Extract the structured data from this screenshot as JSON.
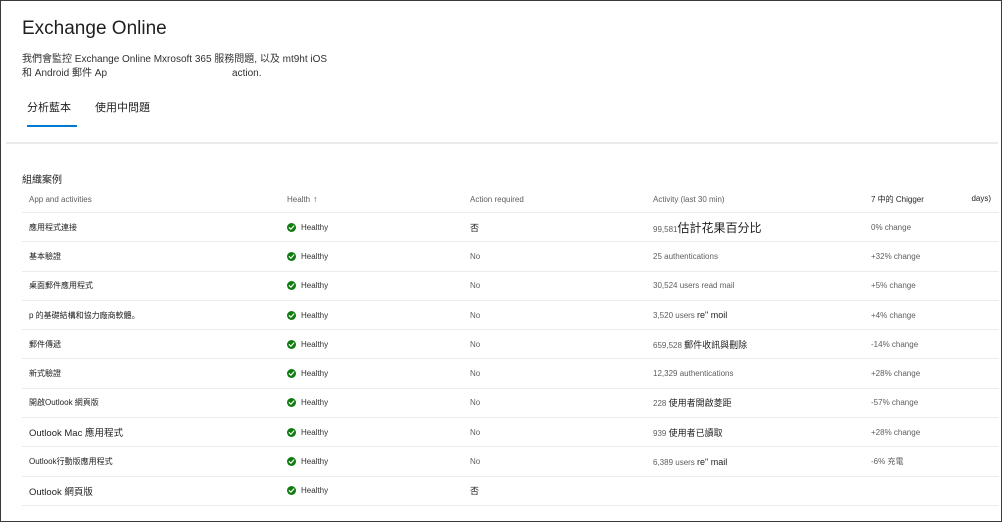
{
  "header": {
    "title": "Exchange Online",
    "description_line1": "我們會監控 Exchange Online Mxrosoft 365 服務問題, 以及 mt9ht iOS",
    "description_line2a": "和 Android 郵件 Ap",
    "description_line2b": "action."
  },
  "tabs": [
    {
      "label": "分析藍本",
      "active": true
    },
    {
      "label": "使用中問題",
      "active": false
    }
  ],
  "section_label": "組織案例",
  "columns": {
    "app": "App and activities",
    "health": "Health",
    "health_sort_icon": "↑",
    "action": "Action required",
    "activity": "Activity (last 30 min)",
    "change_a": "7 中的 Chigger",
    "change_b": "days)"
  },
  "colors": {
    "accent": "#0078d4",
    "healthy": "#107c10"
  },
  "rows": [
    {
      "app": "應用程式連接",
      "health": "Healthy",
      "action": "否",
      "activity_a": "99,581",
      "activity_b": "估計花果百分比",
      "change": "0% change"
    },
    {
      "app": "基本驗證",
      "health": "Healthy",
      "action": "No",
      "activity_a": "25 authentications",
      "activity_b": "",
      "change": "+32% change"
    },
    {
      "app": "桌面郵件應用程式",
      "health": "Healthy",
      "action": "No",
      "activity_a": "30,524 users read mail",
      "activity_b": "",
      "change": "+5% change"
    },
    {
      "app": "p 的基礎結構和協力廠商軟體。",
      "health": "Healthy",
      "action": "No",
      "activity_a": "3,520 users",
      "activity_b": "re\" moil",
      "change": "+4% change"
    },
    {
      "app": "郵件傳遞",
      "health": "Healthy",
      "action": "No",
      "activity_a": "659,528",
      "activity_b": "郵件收訊與刪除",
      "change": "-14% change"
    },
    {
      "app": "新式驗證",
      "health": "Healthy",
      "action": "No",
      "activity_a": "12,329 authentications",
      "activity_b": "",
      "change": "+28% change"
    },
    {
      "app": "開啟Outlook 網頁版",
      "health": "Healthy",
      "action": "No",
      "activity_a": "228",
      "activity_b": "使用者開啟菱距",
      "change": "-57% change"
    },
    {
      "app": "Outlook Mac 應用程式",
      "health": "Healthy",
      "action": "No",
      "activity_a": "939",
      "activity_b": "使用者已讀取",
      "change": "+28% change"
    },
    {
      "app": "Outlook行動版應用程式",
      "health": "Healthy",
      "action": "No",
      "activity_a": "6,389 users",
      "activity_b": "re\" mail",
      "change": "-6% 充電"
    },
    {
      "app": "Outlook 網頁版",
      "health": "Healthy",
      "action": "否",
      "activity_a": "",
      "activity_b": "",
      "change": ""
    }
  ]
}
